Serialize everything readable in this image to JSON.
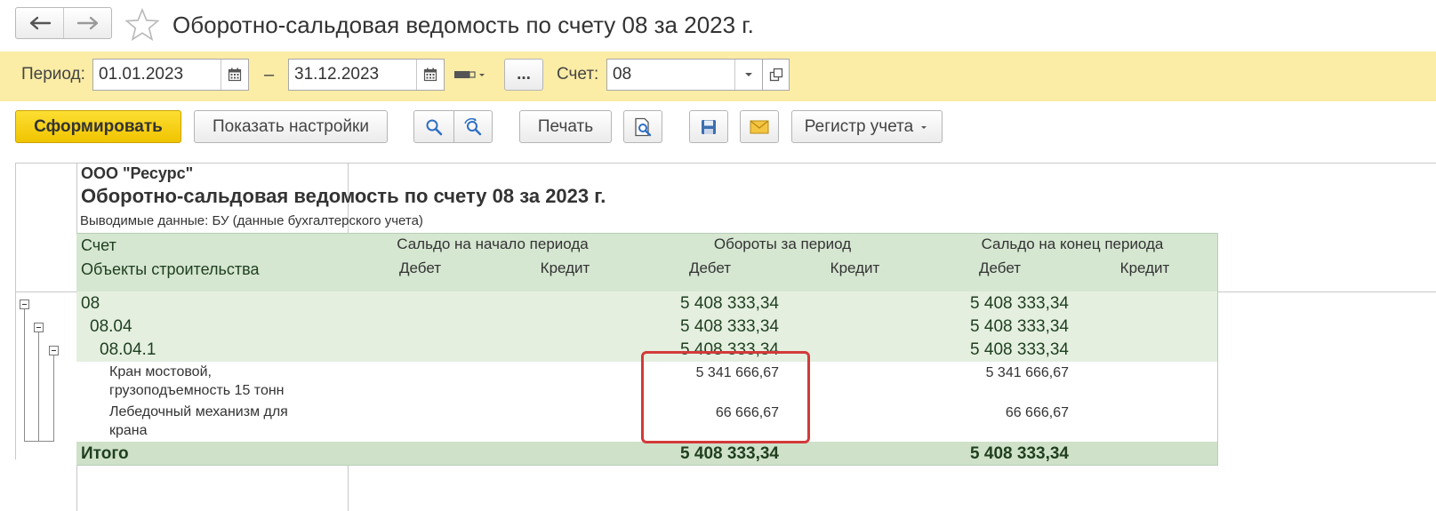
{
  "window": {
    "title": "Оборотно-сальдовая ведомость по счету 08 за 2023 г."
  },
  "filters": {
    "period_label": "Период:",
    "date_from": "01.01.2023",
    "dash": "–",
    "date_to": "31.12.2023",
    "ellipsis": "...",
    "account_label": "Счет:",
    "account_value": "08"
  },
  "toolbar": {
    "generate": "Сформировать",
    "show_settings": "Показать настройки",
    "print": "Печать",
    "register": "Регистр учета"
  },
  "report": {
    "org": "ООО \"Ресурс\"",
    "heading": "Оборотно-сальдовая ведомость по счету 08 за 2023 г.",
    "output_data": "Выводимые данные: БУ (данные бухгалтерского учета)",
    "columns": {
      "account": "Счет",
      "objects": "Объекты строительства",
      "opening": "Сальдо на начало периода",
      "turnover": "Обороты за период",
      "closing": "Сальдо на конец периода",
      "debit": "Дебет",
      "credit": "Кредит"
    },
    "rows": [
      {
        "label": "08",
        "turnover_debit": "5 408 333,34",
        "closing_debit": "5 408 333,34"
      },
      {
        "label": "08.04",
        "turnover_debit": "5 408 333,34",
        "closing_debit": "5 408 333,34"
      },
      {
        "label": "08.04.1",
        "turnover_debit": "5 408 333,34",
        "closing_debit": "5 408 333,34"
      },
      {
        "label_line1": "Кран мостовой,",
        "label_line2": "грузоподъемность 15 тонн",
        "turnover_debit": "5 341 666,67",
        "closing_debit": "5 341 666,67"
      },
      {
        "label_line1": "Лебедочный механизм для",
        "label_line2": "крана",
        "turnover_debit": "66 666,67",
        "closing_debit": "66 666,67"
      }
    ],
    "total": {
      "label": "Итого",
      "turnover_debit": "5 408 333,34",
      "closing_debit": "5 408 333,34"
    }
  },
  "colors": {
    "filter_bar": "#fbeca6",
    "header_green": "#d5e6d1",
    "group_green": "#e4efe0",
    "total_green": "#cfe1c9",
    "highlight_red": "#d33a3a",
    "primary_yellow": "#f5cc00"
  },
  "icons": [
    "back-arrow-icon",
    "forward-arrow-icon",
    "favorite-star-icon",
    "calendar-icon",
    "period-variant-icon",
    "dropdown-arrow-icon",
    "open-form-icon",
    "search-icon",
    "search-next-icon",
    "print-preview-icon",
    "save-icon",
    "mail-icon"
  ]
}
